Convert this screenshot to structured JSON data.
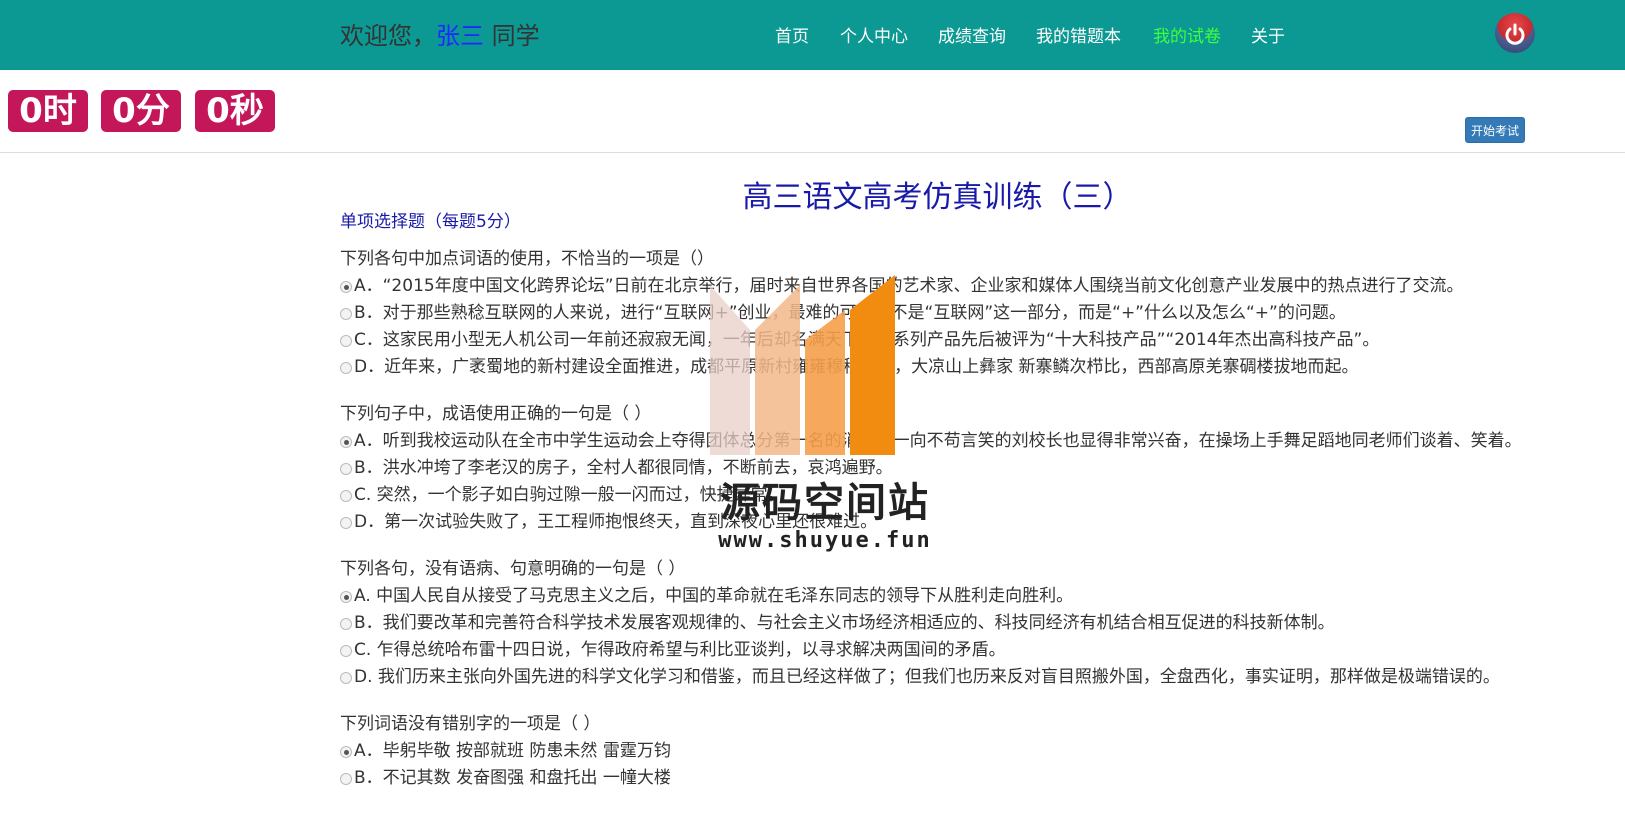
{
  "header": {
    "welcome_prefix": "欢迎您，",
    "user_name": "张三",
    "welcome_suffix": " 同学"
  },
  "nav": {
    "items": [
      {
        "label": "首页"
      },
      {
        "label": "个人中心"
      },
      {
        "label": "成绩查询"
      },
      {
        "label": "我的错题本"
      },
      {
        "label": "我的试卷",
        "active": true
      },
      {
        "label": "关于"
      }
    ]
  },
  "timer": {
    "hours": "0时",
    "minutes": "0分",
    "seconds": "0秒"
  },
  "start_button": "开始考试",
  "exam": {
    "title": "高三语文高考仿真训练（三）",
    "section": "单项选择题（每题5分）",
    "questions": [
      {
        "text": "下列各句中加点词语的使用，不恰当的一项是（）",
        "options": [
          {
            "label": "A．“2015年度中国文化跨界论坛”日前在北京举行，届时来自世界各国的艺术家、企业家和媒体人围绕当前文化创意产业发展中的热点进行了交流。",
            "checked": true
          },
          {
            "label": "B．对于那些熟稔互联网的人来说，进行“互联网+”创业，最难的可能并不是“互联网”这一部分，而是“+”什么以及怎么“+”的问题。"
          },
          {
            "label": "C．这家民用小型无人机公司一年前还寂寂无闻，一年后却名满天下，其系列产品先后被评为“十大科技产品”“2014年杰出高科技产品”。"
          },
          {
            "label": "D．近年来，广袤蜀地的新村建设全面推进，成都平原新村雍雍穆穆棋雍，大凉山上彝家 新寨鳞次栉比，西部高原羌寨碉楼拔地而起。"
          }
        ]
      },
      {
        "text": "下列句子中，成语使用正确的一句是（ ）",
        "options": [
          {
            "label": "A．听到我校运动队在全市中学生运动会上夺得团体总分第一名的消息，一向不苟言笑的刘校长也显得非常兴奋，在操场上手舞足蹈地同老师们谈着、笑着。",
            "checked": true
          },
          {
            "label": "B．洪水冲垮了李老汉的房子，全村人都很同情，不断前去，哀鸿遍野。"
          },
          {
            "label": "C. 突然，一个影子如白驹过隙一般一闪而过，快捷异常。"
          },
          {
            "label": "D．第一次试验失败了，王工程师抱恨终天，直到深夜心里还很难过。"
          }
        ]
      },
      {
        "text": "下列各句，没有语病、句意明确的一句是（ ）",
        "options": [
          {
            "label": "A. 中国人民自从接受了马克思主义之后，中国的革命就在毛泽东同志的领导下从胜利走向胜利。",
            "checked": true
          },
          {
            "label": "B．我们要改革和完善符合科学技术发展客观规律的、与社会主义市场经济相适应的、科技同经济有机结合相互促进的科技新体制。"
          },
          {
            "label": "C. 乍得总统哈布雷十四日说，乍得政府希望与利比亚谈判，以寻求解决两国间的矛盾。"
          },
          {
            "label": "D. 我们历来主张向外国先进的科学文化学习和借鉴，而且已经这样做了；但我们也历来反对盲目照搬外国，全盘西化，事实证明，那样做是极端错误的。"
          }
        ]
      },
      {
        "text": "下列词语没有错别字的一项是（ ）",
        "options": [
          {
            "label": "A．毕躬毕敬 按部就班 防患未然 雷霆万钧",
            "checked": true
          },
          {
            "label": "B．不记其数 发奋图强 和盘托出 一幢大楼"
          }
        ]
      }
    ]
  },
  "watermark": {
    "name": "源码空间站",
    "url": "www.shuyue.fun"
  }
}
